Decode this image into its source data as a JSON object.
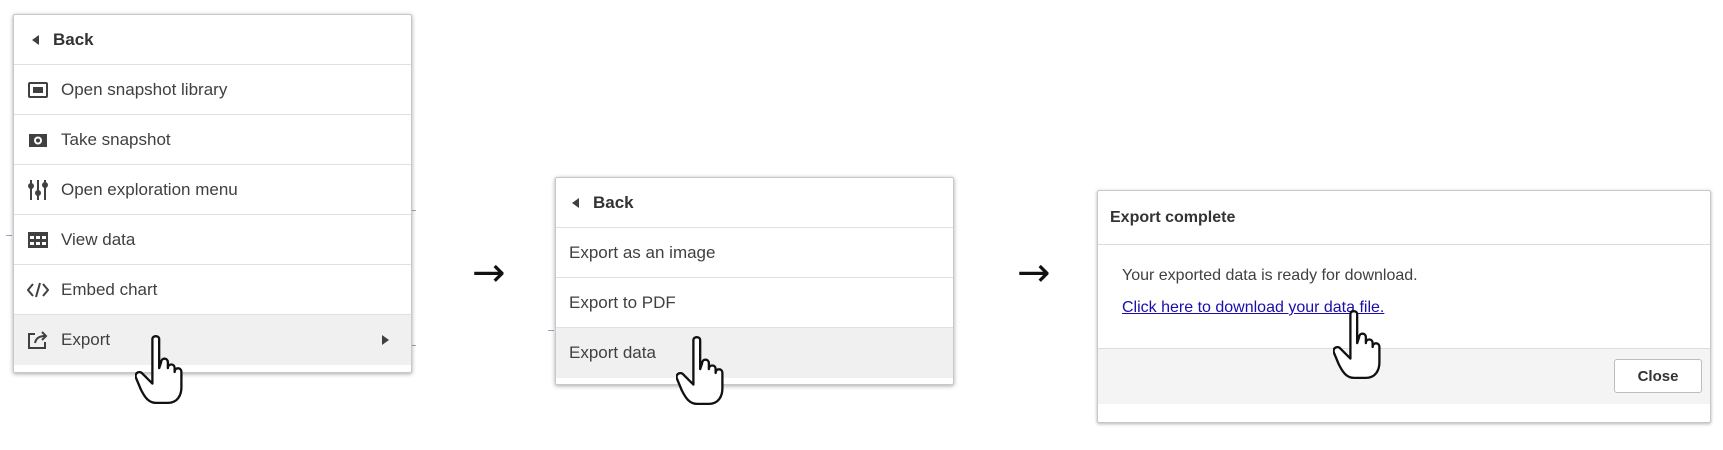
{
  "menu1": {
    "back_label": "Back",
    "items": [
      {
        "label": "Open snapshot library",
        "icon": "snapshot-library-icon"
      },
      {
        "label": "Take snapshot",
        "icon": "camera-icon"
      },
      {
        "label": "Open exploration menu",
        "icon": "sliders-icon"
      },
      {
        "label": "View data",
        "icon": "table-icon"
      },
      {
        "label": "Embed chart",
        "icon": "code-icon"
      },
      {
        "label": "Export",
        "icon": "export-icon"
      }
    ]
  },
  "menu2": {
    "back_label": "Back",
    "items": [
      {
        "label": "Export as an image"
      },
      {
        "label": "Export to PDF"
      },
      {
        "label": "Export data"
      }
    ]
  },
  "dialog": {
    "title": "Export complete",
    "message": "Your exported data is ready for download.",
    "link": "Click here to download your data file.",
    "close_label": "Close"
  },
  "arrow_glyph": "→"
}
